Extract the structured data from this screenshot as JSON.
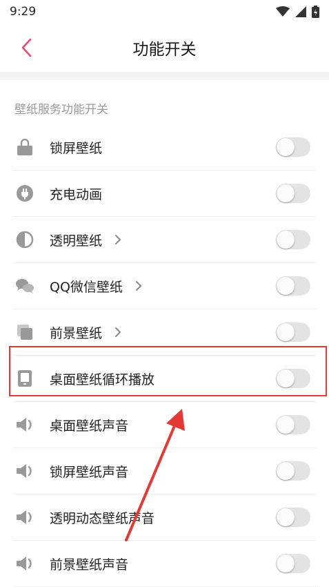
{
  "status_bar": {
    "time": "9:29"
  },
  "app_bar": {
    "title": "功能开关"
  },
  "section": {
    "title": "壁纸服务功能开关",
    "items": [
      {
        "label": "锁屏壁纸",
        "icon": "lock-icon",
        "has_arrow": false,
        "enabled": false
      },
      {
        "label": "充电动画",
        "icon": "plug-icon",
        "has_arrow": false,
        "enabled": false
      },
      {
        "label": "透明壁纸",
        "icon": "contrast-icon",
        "has_arrow": true,
        "enabled": false
      },
      {
        "label": "QQ微信壁纸",
        "icon": "chat-icon",
        "has_arrow": true,
        "enabled": false
      },
      {
        "label": "前景壁纸",
        "icon": "layers-icon",
        "has_arrow": true,
        "enabled": false
      },
      {
        "label": "桌面壁纸循环播放",
        "icon": "tablet-icon",
        "has_arrow": false,
        "enabled": false
      },
      {
        "label": "桌面壁纸声音",
        "icon": "speaker-icon",
        "has_arrow": false,
        "enabled": false
      },
      {
        "label": "锁屏壁纸声音",
        "icon": "speaker-icon",
        "has_arrow": false,
        "enabled": false
      },
      {
        "label": "透明动态壁纸声音",
        "icon": "speaker-icon",
        "has_arrow": false,
        "enabled": false
      },
      {
        "label": "前景壁纸声音",
        "icon": "speaker-icon",
        "has_arrow": false,
        "enabled": false
      }
    ]
  },
  "colors": {
    "accent": "#e8486a",
    "annotation": "#e53935",
    "icon": "#999999"
  }
}
